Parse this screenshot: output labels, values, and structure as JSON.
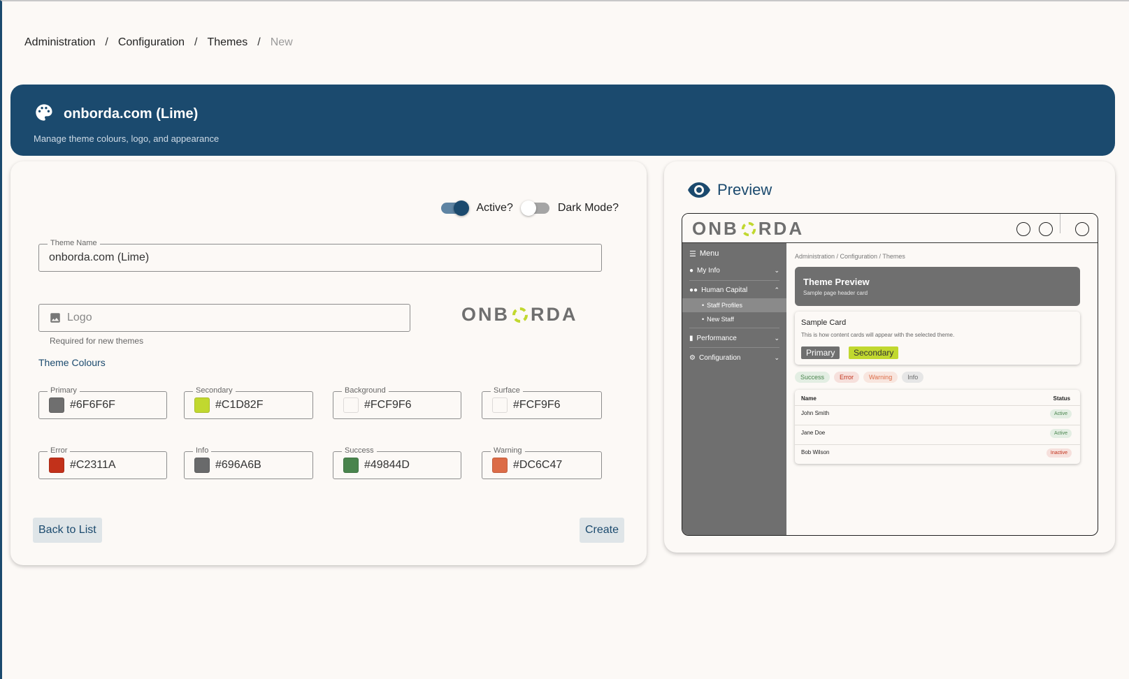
{
  "breadcrumb": {
    "items": [
      "Administration",
      "Configuration",
      "Themes",
      "New"
    ],
    "separator": "/"
  },
  "header": {
    "title": "onborda.com (Lime)",
    "subtitle": "Manage theme colours, logo, and appearance",
    "icon": "palette-icon",
    "bg_color": "#1B4A6E"
  },
  "toggles": {
    "active_label": "Active?",
    "active_on": true,
    "dark_mode_label": "Dark Mode?",
    "dark_mode_on": false
  },
  "form": {
    "theme_name_label": "Theme Name",
    "theme_name_value": "onborda.com (Lime)",
    "logo_placeholder": "Logo",
    "logo_hint": "Required for new themes",
    "logo_text_left": "ONB",
    "logo_text_right": "RDA",
    "colours_heading": "Theme Colours",
    "colours": [
      {
        "label": "Primary",
        "value": "#6F6F6F"
      },
      {
        "label": "Secondary",
        "value": "#C1D82F"
      },
      {
        "label": "Background",
        "value": "#FCF9F6"
      },
      {
        "label": "Surface",
        "value": "#FCF9F6"
      },
      {
        "label": "Error",
        "value": "#C2311A"
      },
      {
        "label": "Info",
        "value": "#696A6B"
      },
      {
        "label": "Success",
        "value": "#49844D"
      },
      {
        "label": "Warning",
        "value": "#DC6C47"
      }
    ],
    "back_button": "Back to List",
    "create_button": "Create"
  },
  "preview": {
    "title": "Preview",
    "logo_text_left": "ONB",
    "logo_text_right": "RDA",
    "menu": {
      "menu_label": "Menu",
      "my_info": "My Info",
      "human_capital": "Human Capital",
      "staff_profiles": "Staff Profiles",
      "new_staff": "New Staff",
      "performance": "Performance",
      "configuration": "Configuration"
    },
    "breadcrumb": "Administration / Configuration / Themes",
    "header_title": "Theme Preview",
    "header_subtitle": "Sample page header card",
    "card_title": "Sample Card",
    "card_text": "This is how content cards will appear with the selected theme.",
    "primary_btn": "Primary",
    "secondary_btn": "Secondary",
    "chips": [
      "Success",
      "Error",
      "Warning",
      "Info"
    ],
    "table": {
      "col_name": "Name",
      "col_status": "Status",
      "rows": [
        {
          "name": "John Smith",
          "status": "Active"
        },
        {
          "name": "Jane Doe",
          "status": "Active"
        },
        {
          "name": "Bob Wilson",
          "status": "Inactive"
        }
      ]
    }
  }
}
